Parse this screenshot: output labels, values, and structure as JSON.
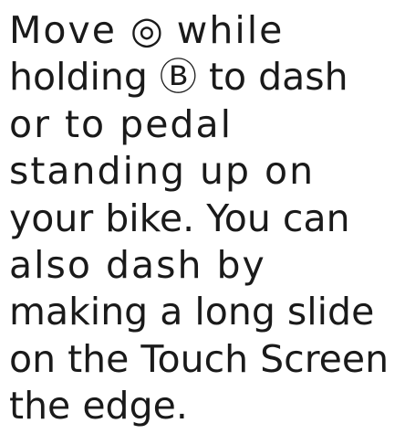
{
  "help_text": {
    "lines": [
      {
        "before": "Move ",
        "icon": "◎",
        "icon_name": "circle-pad-icon",
        "after": " while"
      },
      {
        "before": "holding ",
        "icon": "Ⓑ",
        "icon_name": "b-button-icon",
        "after": " to dash"
      },
      {
        "text": "or to pedal"
      },
      {
        "text": "standing up on"
      },
      {
        "text": "your bike. You can"
      },
      {
        "text": "also dash by"
      },
      {
        "text": "making a long slide"
      },
      {
        "text": "on the Touch Screen"
      },
      {
        "text": "the edge."
      }
    ]
  }
}
